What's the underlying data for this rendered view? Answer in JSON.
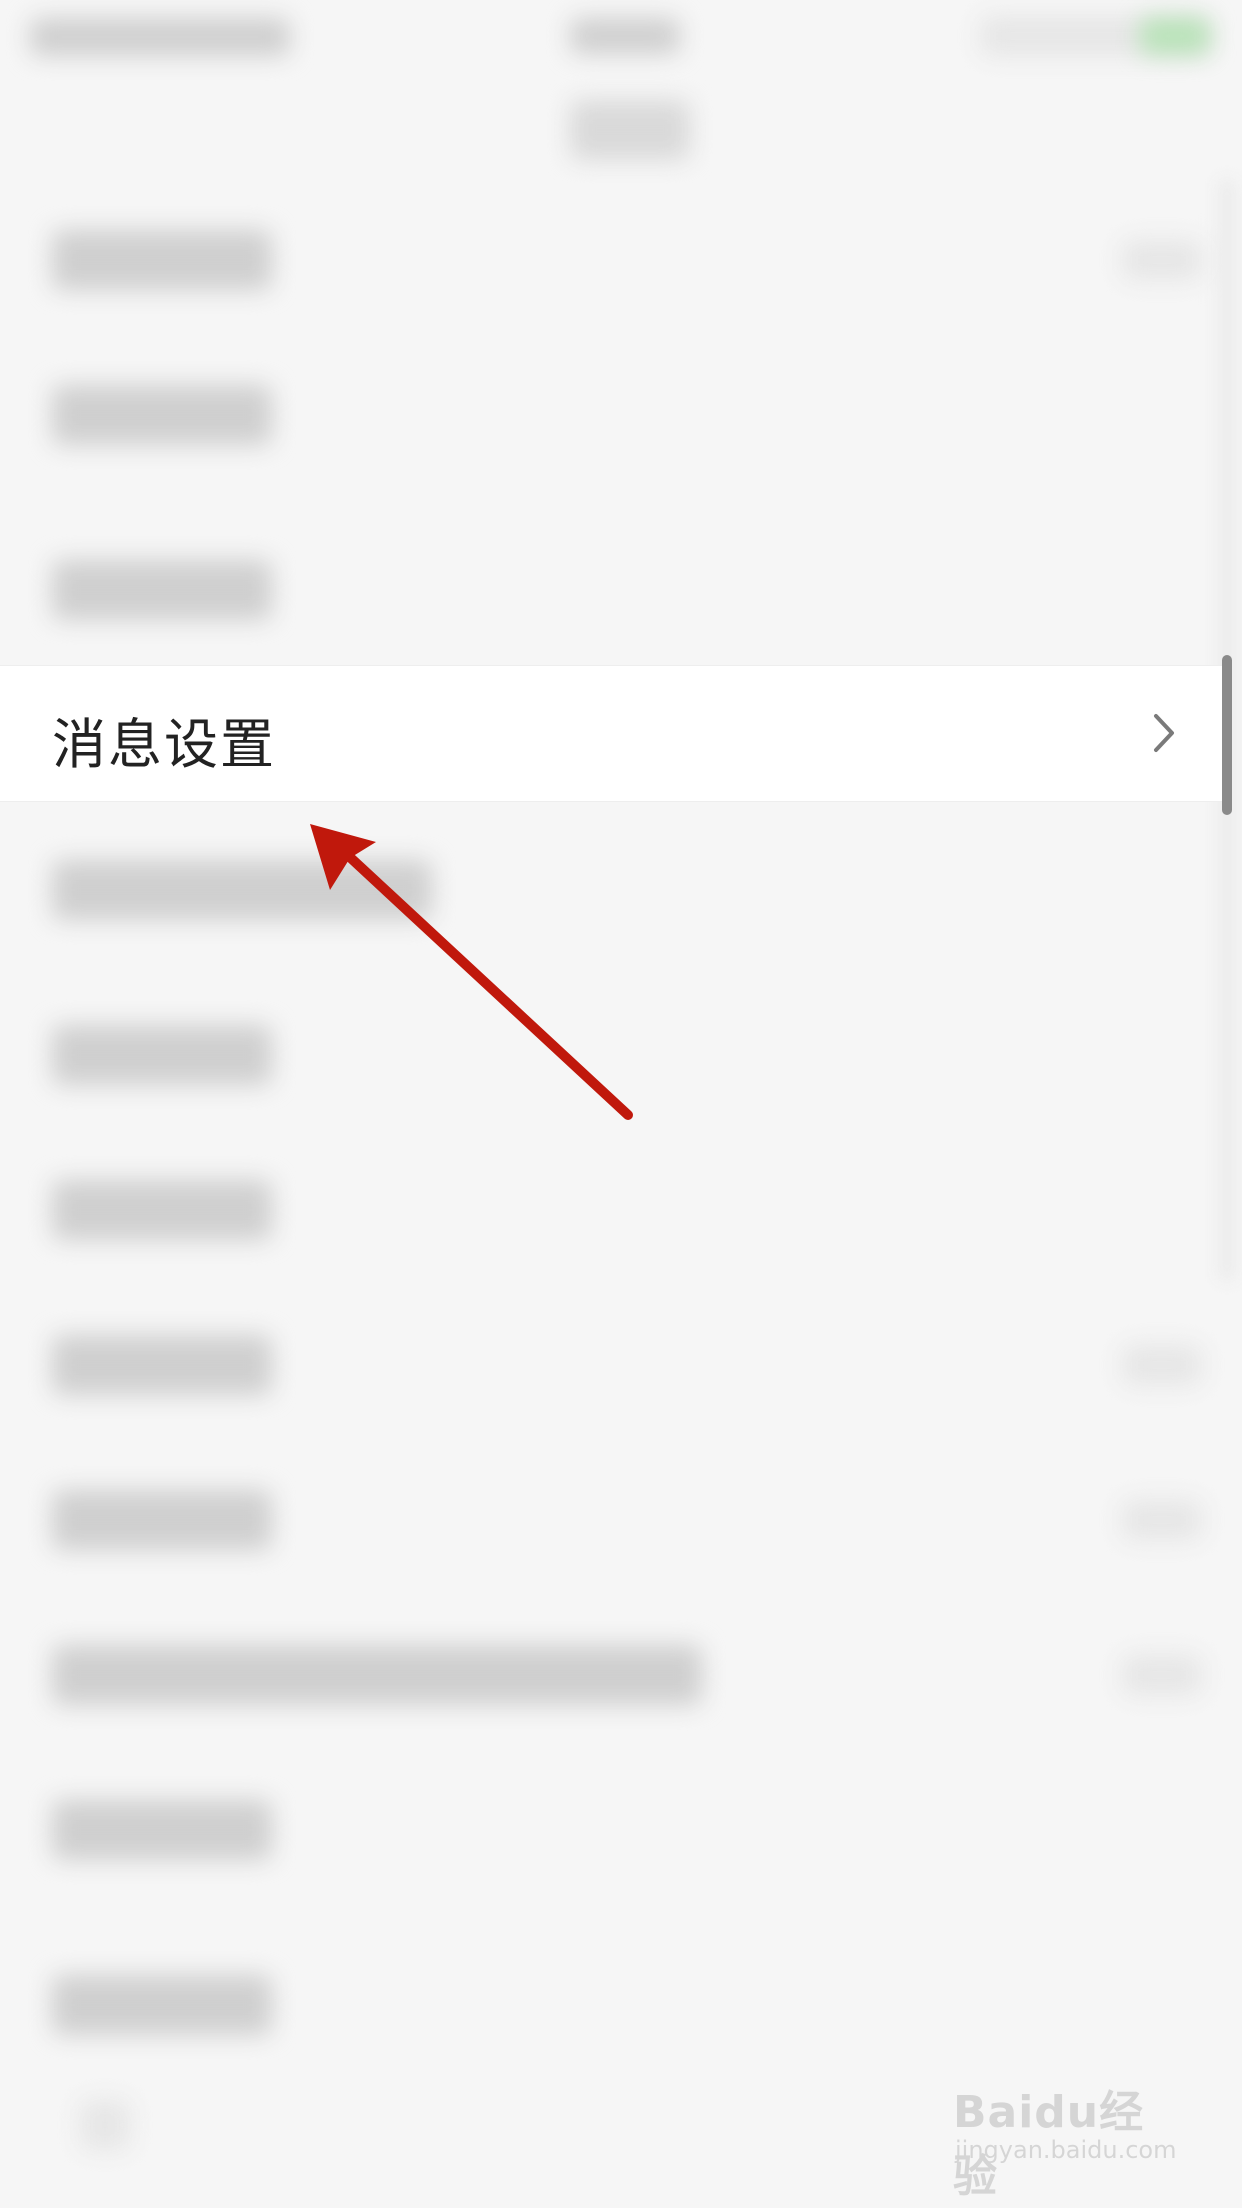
{
  "settings_list": {
    "highlighted_item": {
      "label": "消息设置"
    }
  },
  "watermark": {
    "brand": "Baidu经验",
    "url": "jingyan.baidu.com"
  },
  "colors": {
    "arrow": "#c0180c",
    "background": "#f6f6f6",
    "row_background": "#ffffff"
  }
}
